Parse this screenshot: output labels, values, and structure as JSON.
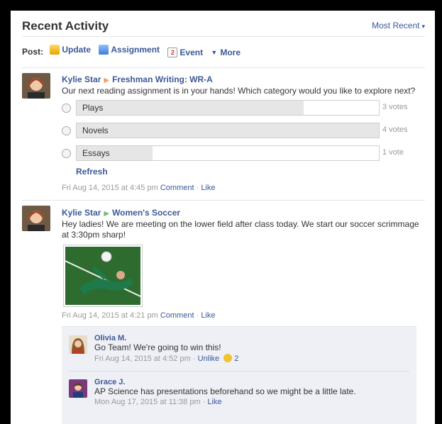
{
  "header": {
    "title": "Recent Activity",
    "sort_label": "Most Recent"
  },
  "postbar": {
    "label": "Post:",
    "actions": [
      {
        "label": "Update",
        "icon": "pencil-note-icon"
      },
      {
        "label": "Assignment",
        "icon": "assignment-icon"
      },
      {
        "label": "Event",
        "icon": "calendar-icon",
        "icon_text": "2"
      },
      {
        "label": "More",
        "icon": "caret-down-icon"
      }
    ]
  },
  "posts": [
    {
      "author": "Kylie Star",
      "group": "Freshman Writing: WR-A",
      "text": "Our next reading assignment is in your hands! Which category would you like to explore next?",
      "poll": [
        {
          "option": "Plays",
          "votes_text": "3 votes",
          "share": 0.75
        },
        {
          "option": "Novels",
          "votes_text": "4 votes",
          "share": 1.0
        },
        {
          "option": "Essays",
          "votes_text": "1 vote",
          "share": 0.25
        }
      ],
      "refresh": "Refresh",
      "timestamp": "Fri Aug 14, 2015 at 4:45 pm",
      "comment_link": "Comment",
      "like_link": "Like"
    },
    {
      "author": "Kylie Star",
      "group": "Women's Soccer",
      "text_line1": "Hey ladies! We are meeting on the lower field after class today. We start our soccer scrimmage",
      "text_line2": "at 3:30pm sharp!",
      "timestamp": "Fri Aug 14, 2015 at 4:21 pm",
      "comment_link": "Comment",
      "like_link": "Like",
      "comments": [
        {
          "author": "Olivia M.",
          "text": "Go Team! We're going to win this!",
          "timestamp": "Fri Aug 14, 2015 at 4:52 pm",
          "unlike": "Unlike",
          "like_count": "2"
        },
        {
          "author": "Grace J.",
          "text": "AP Science has presentations beforehand so we might be a little late.",
          "timestamp": "Mon Aug 17, 2015 at 11:38 pm",
          "like": "Like"
        }
      ]
    }
  ],
  "separator": "·"
}
